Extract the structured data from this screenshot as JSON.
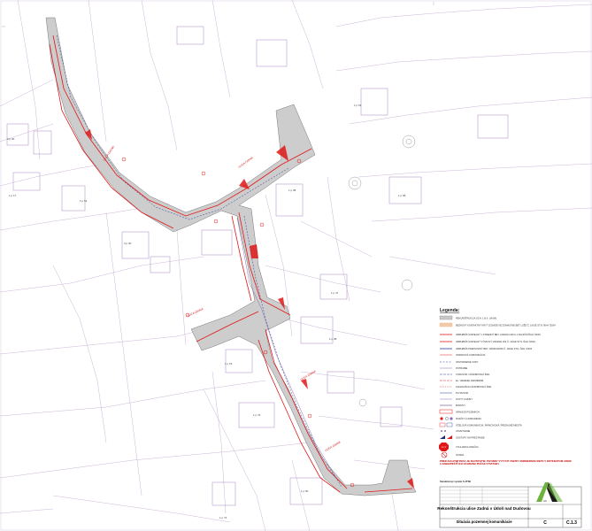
{
  "legend": {
    "title": "Legenda:",
    "items": [
      {
        "label": "REKONŠTRUKCIA OCH. 1 B.X. (VIAIA)",
        "kind": "fill-gray"
      },
      {
        "label": "BEZHOVÝ KONTAKTNÝ KRYT ZOSADE VÉ ZOMASÍ NE BET LOŽE Č. 16/GE ST.N. ŇAH 72004",
        "kind": "fill-peach"
      },
      {
        "label": "OBRUBNÍK SVETELNÝ 1 STREDNÝ BET. 100/20/H 200 A 1 SILNIČNÍ ŇAH 72004",
        "kind": "line-red"
      },
      {
        "label": "OBRUBNÍK SVETELNÝ VÝSKOVÝ 100/20/H 200 Č. 16/GE ST.N. ŇAH 72004",
        "kind": "line-red"
      },
      {
        "label": "OBRUBNÍK PREDVODNÝ BET. 1000/100/250 Č. 16/GE ST.N. ŇAH 72004",
        "kind": "line-blue"
      },
      {
        "label": "ODRAVOVÁ KOMUNIKÁCIA",
        "kind": "line-red-thin"
      },
      {
        "label": "ODVODNENIE VODY",
        "kind": "dash-blue"
      },
      {
        "label": "POTRUBIE",
        "kind": "line-purple"
      },
      {
        "label": "VODOVOD / ZÁSOBOVACÍ ŘAD",
        "kind": "dash-blue"
      },
      {
        "label": "EL. VEDENIE NADZEMNÉ",
        "kind": "dash-red"
      },
      {
        "label": "KANALIZÁCIA ZÁSOBOVACÍ ŘAD",
        "kind": "dash-red"
      },
      {
        "label": "PLYNOVOD",
        "kind": "line-blue"
      },
      {
        "label": "PLOTY A MÚRY",
        "kind": "line-purple"
      },
      {
        "label": "BUDOVY",
        "kind": "line-purple"
      },
      {
        "label": "HRANICE POZEMKOV",
        "kind": "box-red"
      },
      {
        "label": "ZNAČKY A ZARIADENIA",
        "kind": "markers"
      },
      {
        "label": "ÚČELOVÁ KOMUNIKÁCIA, PARKOVISKÁ, PREDAJNÉ MIESTA",
        "kind": "hatch"
      },
      {
        "label": "OSVETLENIE",
        "kind": "dots"
      },
      {
        "label": "ODSTUPY NA PRESTAVBE",
        "kind": "triangles"
      },
      {
        "label": "VYHLIADKA ZNAČKA",
        "kind": "stop"
      },
      {
        "label": "SONDA",
        "kind": "nosign"
      }
    ]
  },
  "notes": {
    "warning": "PRED ZAČATÍM PRÁC JE ZHOTOVITEĽ POVINNÝ VYTÝČIŤ VŠETKY INŽINIERSKE SIETE V DOTKNUTOM ÚZEMÍ A ZABEZPEČIŤ ICH OCHRANU POČAS VÝSTAVBY",
    "scale": "Súradnicový systém S-JTSK"
  },
  "title_block": {
    "logo_letter": "AK",
    "project": "Rekonštrukcia ulice Zadná v Údolí nad Dudovou",
    "drawing": "Situácia pozemnej komunikácie",
    "sheet": "C.1.3",
    "part": "C"
  },
  "map": {
    "parcel_labels": [
      "3 p 30",
      "1 p 17",
      "1 p 52",
      "3 p 30",
      "1 p 15",
      "1 p 76",
      "1 p 38",
      "1 p 47",
      "1 p 63",
      "1 p 68",
      "1 p 08",
      "1 p 50",
      "1 p 74"
    ],
    "street_labels": [
      "ULICA ZADNÁ",
      "ULICA ZADNÁ",
      "ULICA ZADNÁ",
      "ULICA ZADNÁ",
      "ULICA ZADNÁ"
    ]
  },
  "colors": {
    "road": "#c8c8c8",
    "red": "#e01818",
    "blue": "#2a3f9a",
    "purple": "#8a6fb0",
    "parcel": "#c8b0d4"
  }
}
